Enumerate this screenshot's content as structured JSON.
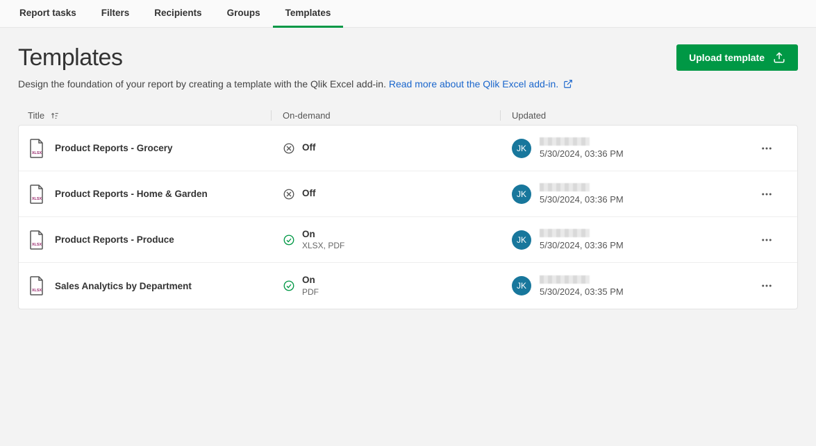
{
  "tabs": [
    {
      "label": "Report tasks",
      "active": false
    },
    {
      "label": "Filters",
      "active": false
    },
    {
      "label": "Recipients",
      "active": false
    },
    {
      "label": "Groups",
      "active": false
    },
    {
      "label": "Templates",
      "active": true
    }
  ],
  "header": {
    "title": "Templates",
    "subtitle": "Design the foundation of your report by creating a template with the Qlik Excel add-in.",
    "link_text": "Read more about the Qlik Excel add-in.",
    "upload_label": "Upload template"
  },
  "columns": {
    "title": "Title",
    "ondemand": "On-demand",
    "updated": "Updated"
  },
  "rows": [
    {
      "title": "Product Reports - Grocery",
      "ondemand_state": "off",
      "ondemand_label": "Off",
      "ondemand_formats": "",
      "avatar": "JK",
      "timestamp": "5/30/2024, 03:36 PM"
    },
    {
      "title": "Product Reports - Home & Garden",
      "ondemand_state": "off",
      "ondemand_label": "Off",
      "ondemand_formats": "",
      "avatar": "JK",
      "timestamp": "5/30/2024, 03:36 PM"
    },
    {
      "title": "Product Reports - Produce",
      "ondemand_state": "on",
      "ondemand_label": "On",
      "ondemand_formats": "XLSX, PDF",
      "avatar": "JK",
      "timestamp": "5/30/2024, 03:36 PM"
    },
    {
      "title": "Sales Analytics by Department",
      "ondemand_state": "on",
      "ondemand_label": "On",
      "ondemand_formats": "PDF",
      "avatar": "JK",
      "timestamp": "5/30/2024, 03:35 PM"
    }
  ]
}
